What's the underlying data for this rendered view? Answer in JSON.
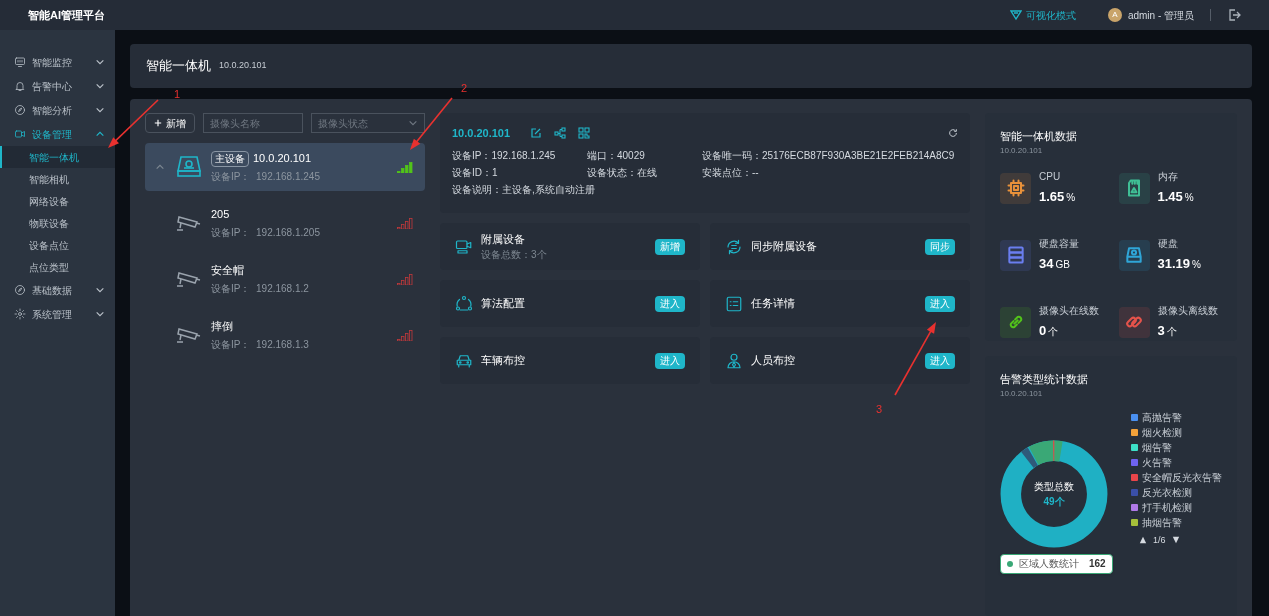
{
  "app_title": "智能AI管理平台",
  "topbar": {
    "mode_link": "可视化模式",
    "avatar_letter": "A",
    "user": "admin - 管理员"
  },
  "sidebar": {
    "items": [
      {
        "label": "智能监控",
        "expanded": false
      },
      {
        "label": "告警中心",
        "expanded": false
      },
      {
        "label": "智能分析",
        "expanded": false
      },
      {
        "label": "设备管理",
        "expanded": true,
        "children": [
          {
            "label": "智能一体机",
            "selected": true
          },
          {
            "label": "智能相机",
            "selected": false
          },
          {
            "label": "网络设备",
            "selected": false
          },
          {
            "label": "物联设备",
            "selected": false
          },
          {
            "label": "设备点位",
            "selected": false
          },
          {
            "label": "点位类型",
            "selected": false
          }
        ]
      },
      {
        "label": "基础数据",
        "expanded": false
      },
      {
        "label": "系统管理",
        "expanded": false
      }
    ]
  },
  "page_header": {
    "title": "智能一体机",
    "subtitle": "10.0.20.101"
  },
  "device_list": {
    "add_button": "新增",
    "name_placeholder": "摄像头名称",
    "status_placeholder": "摄像头状态",
    "devices": [
      {
        "kind": "host",
        "tag": "主设备",
        "name": "10.0.20.101",
        "ip_label": "设备IP：",
        "ip": "192.168.1.245",
        "online": true,
        "selected": true,
        "expanded": true
      },
      {
        "kind": "camera",
        "name": "205",
        "ip_label": "设备IP：",
        "ip": "192.168.1.205",
        "online": false,
        "selected": false
      },
      {
        "kind": "camera",
        "name": "安全帽",
        "ip_label": "设备IP：",
        "ip": "192.168.1.2",
        "online": false,
        "selected": false
      },
      {
        "kind": "camera",
        "name": "摔倒",
        "ip_label": "设备IP：",
        "ip": "192.168.1.3",
        "online": false,
        "selected": false
      }
    ]
  },
  "device_info": {
    "title": "10.0.20.101",
    "fields": [
      {
        "label": "设备IP：",
        "value": "192.168.1.245"
      },
      {
        "label": "端口：",
        "value": "40029"
      },
      {
        "label": "设备唯一码：",
        "value": "25176ECB87F930A3BE21E2FEB214A8C9"
      },
      {
        "label": "设备ID：",
        "value": "1"
      },
      {
        "label": "设备状态：",
        "value": "在线"
      },
      {
        "label": "安装点位：",
        "value": "--"
      },
      {
        "label": "设备说明：",
        "value": "主设备,系统自动注册"
      }
    ]
  },
  "actions": [
    {
      "title": "附属设备",
      "subtitle": "设备总数：3个",
      "button": "新增"
    },
    {
      "title": "同步附属设备",
      "button": "同步"
    },
    {
      "title": "算法配置",
      "button": "进入"
    },
    {
      "title": "任务详情",
      "button": "进入"
    },
    {
      "title": "车辆布控",
      "button": "进入"
    },
    {
      "title": "人员布控",
      "button": "进入"
    }
  ],
  "stats": {
    "title": "智能一体机数据",
    "subtitle": "10.0.20.101",
    "items": [
      {
        "label": "CPU",
        "value": "1.65",
        "unit": "%",
        "color": "#e8913a"
      },
      {
        "label": "内存",
        "value": "1.45",
        "unit": "%",
        "color": "#3fbf95"
      },
      {
        "label": "硬盘容量",
        "value": "34",
        "unit": "GB",
        "color": "#6a7ef0"
      },
      {
        "label": "硬盘",
        "value": "31.19",
        "unit": "%",
        "color": "#2fa6d8"
      },
      {
        "label": "摄像头在线数",
        "value": "0",
        "unit": "个",
        "color": "#52c41a"
      },
      {
        "label": "摄像头离线数",
        "value": "3",
        "unit": "个",
        "color": "#e5534b"
      }
    ]
  },
  "alarms": {
    "title": "告警类型统计数据",
    "subtitle": "10.0.20.101",
    "center_label": "类型总数",
    "center_value": "49个",
    "legend": [
      {
        "label": "高抛告警",
        "color": "#4a90f0"
      },
      {
        "label": "烟火检测",
        "color": "#f3a23a"
      },
      {
        "label": "烟告警",
        "color": "#3de0c8"
      },
      {
        "label": "火告警",
        "color": "#6f63f0"
      },
      {
        "label": "安全帽反光衣告警",
        "color": "#e8454a"
      },
      {
        "label": "反光衣检测",
        "color": "#3a4fa8"
      },
      {
        "label": "打手机检测",
        "color": "#b07ae8"
      },
      {
        "label": "抽烟告警",
        "color": "#a6c03a"
      }
    ],
    "tooltip": {
      "label": "区域人数统计",
      "value": "162",
      "color": "#3aa876"
    },
    "pager": "1/6"
  },
  "annotations": [
    "1",
    "2",
    "3"
  ]
}
